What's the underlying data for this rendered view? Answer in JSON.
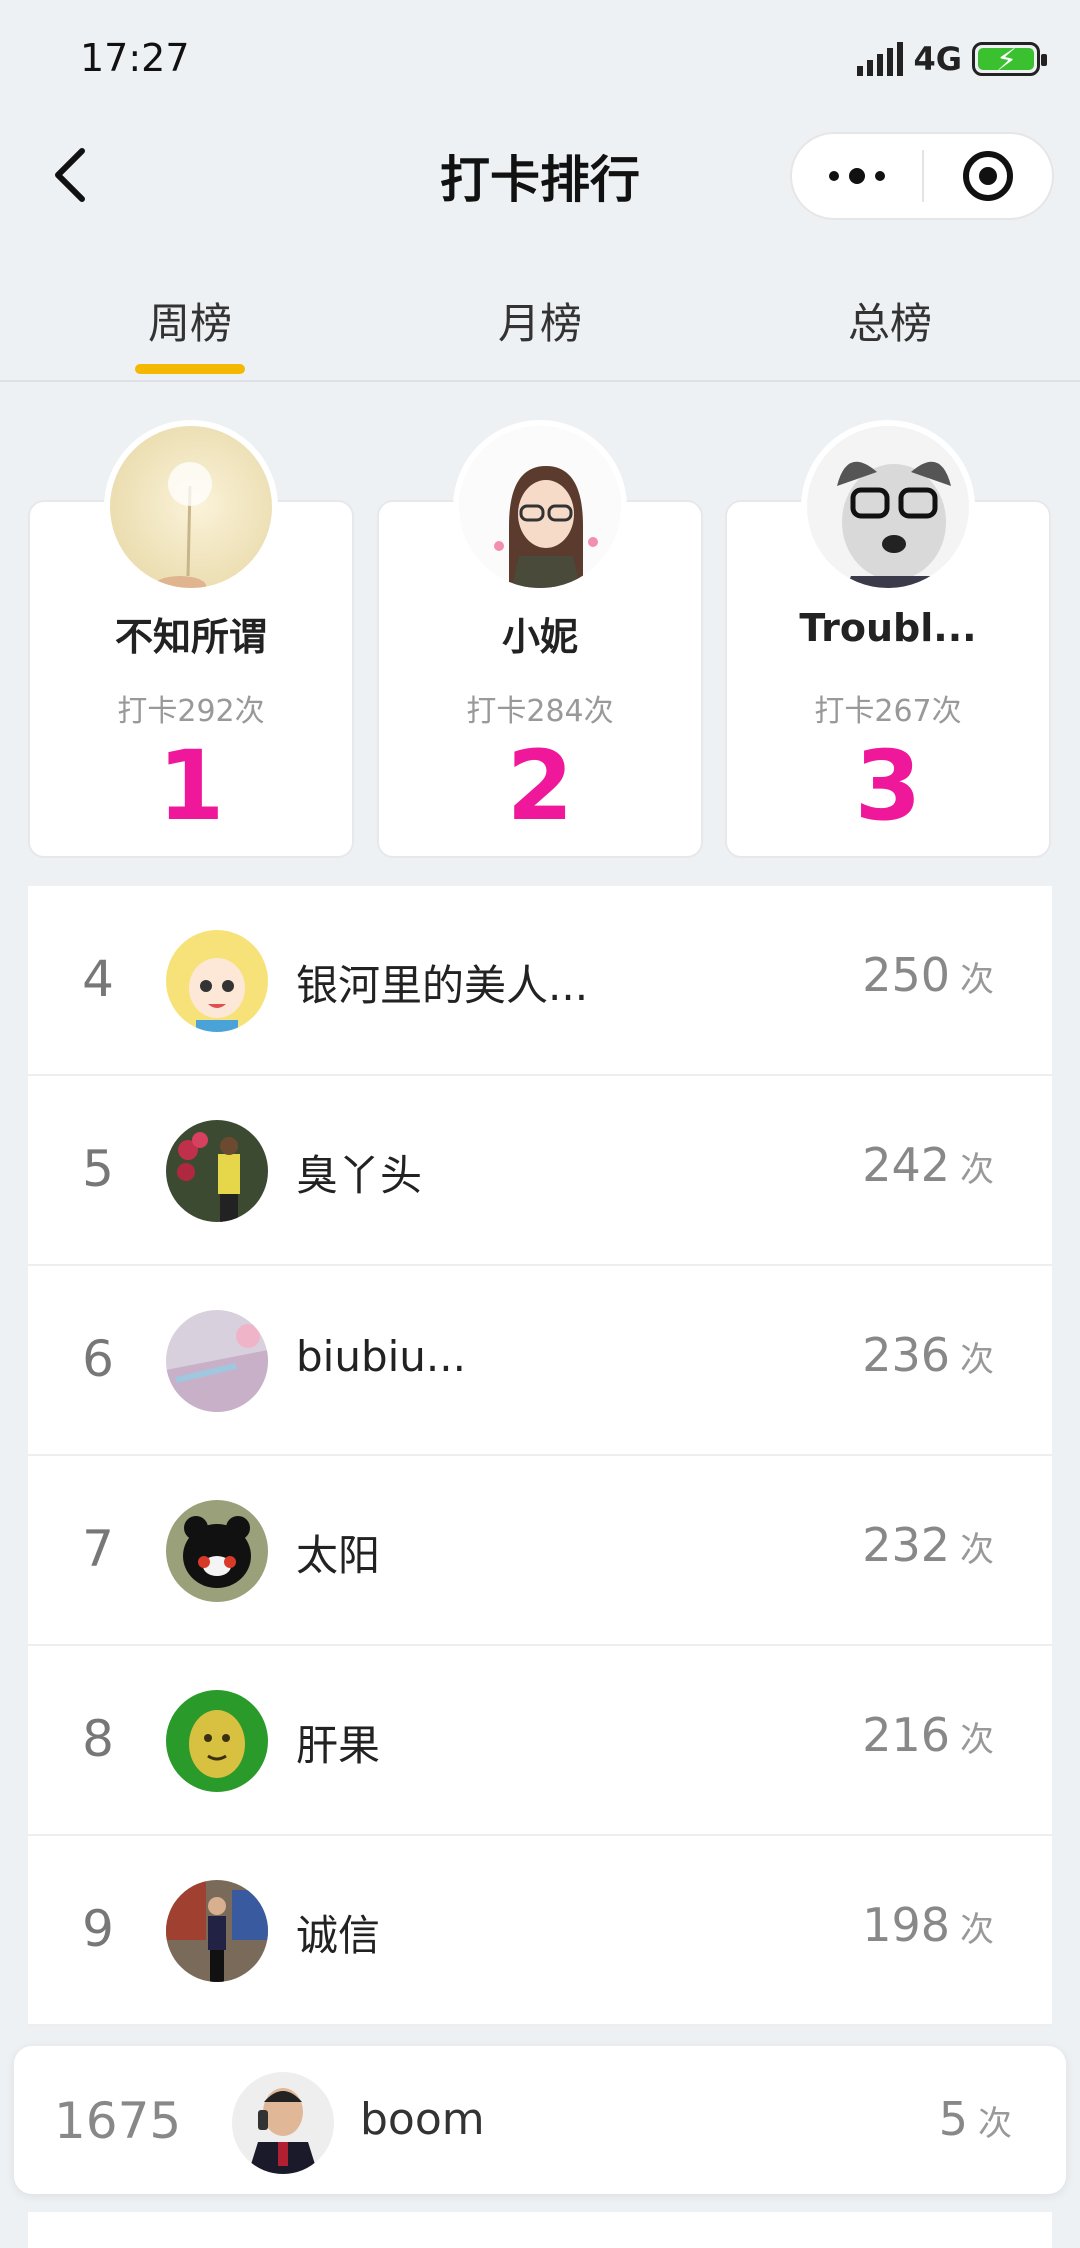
{
  "status_bar": {
    "time": "17:27",
    "network": "4G"
  },
  "nav": {
    "title": "打卡排行"
  },
  "tabs": [
    {
      "label": "周榜",
      "active": true
    },
    {
      "label": "月榜",
      "active": false
    },
    {
      "label": "总榜",
      "active": false
    }
  ],
  "podium": [
    {
      "rank": "1",
      "name": "不知所谓",
      "count_text": "打卡292次",
      "avatar": "dandelion-avatar"
    },
    {
      "rank": "2",
      "name": "小妮",
      "count_text": "打卡284次",
      "avatar": "cartoon-girl-avatar"
    },
    {
      "rank": "3",
      "name": "Troubl...",
      "count_text": "打卡267次",
      "avatar": "dog-glasses-avatar"
    }
  ],
  "list": [
    {
      "rank": "4",
      "name": "银河里的美人...",
      "count": "250",
      "unit": "次",
      "avatar": "anime-girl-avatar"
    },
    {
      "rank": "5",
      "name": "臭丫头",
      "count": "242",
      "unit": "次",
      "avatar": "flowers-photo-avatar"
    },
    {
      "rank": "6",
      "name": "biubiu...",
      "count": "236",
      "unit": "次",
      "avatar": "pastel-photo-avatar"
    },
    {
      "rank": "7",
      "name": "太阳",
      "count": "232",
      "unit": "次",
      "avatar": "bear-mascot-avatar"
    },
    {
      "rank": "8",
      "name": "肝果",
      "count": "216",
      "unit": "次",
      "avatar": "fruit-face-avatar"
    },
    {
      "rank": "9",
      "name": "诚信",
      "count": "198",
      "unit": "次",
      "avatar": "person-photo-avatar"
    }
  ],
  "my_rank": {
    "rank": "1675",
    "name": "boom",
    "count": "5",
    "unit": "次",
    "avatar": "man-phone-avatar"
  },
  "colors": {
    "rank_highlight": "#f0189a",
    "tab_indicator": "#f5b800",
    "battery": "#3bc12f"
  }
}
